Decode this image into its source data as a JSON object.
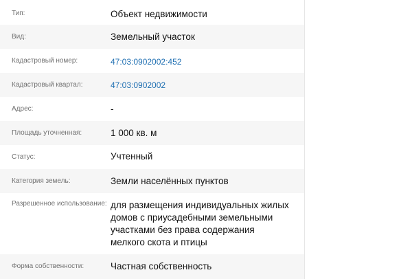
{
  "rows": [
    {
      "label": "Тип:",
      "value": "Объект недвижимости",
      "link": false
    },
    {
      "label": "Вид:",
      "value": "Земельный участок",
      "link": false
    },
    {
      "label": "Кадастровый номер:",
      "value": "47:03:0902002:452",
      "link": true
    },
    {
      "label": "Кадастровый квартал:",
      "value": "47:03:0902002",
      "link": true
    },
    {
      "label": "Адрес:",
      "value": "-",
      "link": false
    },
    {
      "label": "Площадь уточненная:",
      "value": "1 000 кв. м",
      "link": false
    },
    {
      "label": "Статус:",
      "value": "Учтенный",
      "link": false
    },
    {
      "label": "Категория земель:",
      "value": "Земли населённых пунктов",
      "link": false
    },
    {
      "label": "Разрешенное использование:",
      "value": "для размещения индивидуальных жилых домов с приусадебными земельными участками без права содержания мелкого скота и птицы",
      "link": false
    },
    {
      "label": "Форма собственности:",
      "value": "Частная собственность",
      "link": false
    }
  ]
}
